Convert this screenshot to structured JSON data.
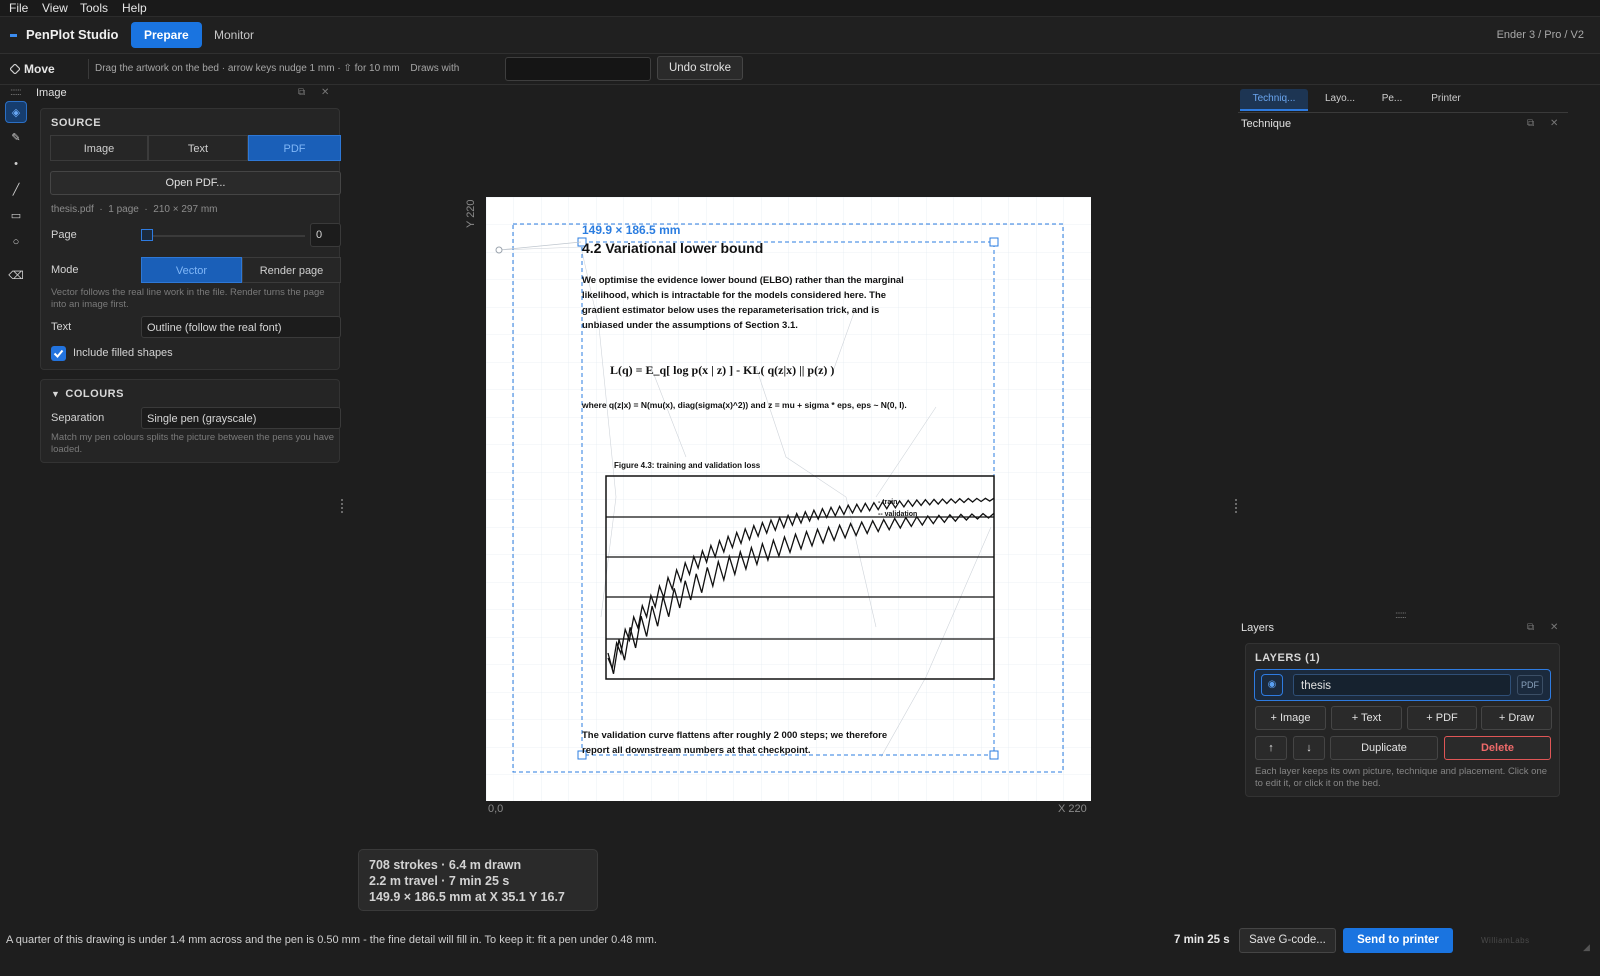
{
  "menu": [
    "File",
    "View",
    "Tools",
    "Help"
  ],
  "app": {
    "name": "PenPlot Studio",
    "tabs": [
      "Prepare",
      "Monitor"
    ],
    "printer": "Ender 3 / Pro / V2"
  },
  "toolbar": {
    "tool": "Move",
    "hint": "Drag the artwork on the bed · arrow keys nudge 1 mm · ⇧ for 10 mm",
    "draws_with_label": "Draws with",
    "draws_with_value": "",
    "undo": "Undo stroke"
  },
  "tools": [
    "move-icon",
    "pen-icon",
    "dot-icon",
    "line-icon",
    "rect-icon",
    "circle-icon",
    "eraser-icon"
  ],
  "image_panel": {
    "title": "Image",
    "source": {
      "heading": "SOURCE",
      "options": [
        "Image",
        "Text",
        "PDF"
      ],
      "selected": "PDF",
      "open_button": "Open PDF...",
      "file_info": "thesis.pdf  ·  1 page  ·  210 × 297 mm",
      "page_label": "Page",
      "page_value": "0",
      "mode_label": "Mode",
      "mode_options": [
        "Vector",
        "Render page"
      ],
      "mode_selected": "Vector",
      "mode_help": "Vector follows the real line work in the file. Render turns the page into an image first.",
      "text_label": "Text",
      "text_value": "Outline (follow the real font)",
      "filled_label": "Include filled shapes",
      "filled_checked": true
    },
    "colours": {
      "heading": "COLOURS",
      "separation_label": "Separation",
      "separation_value": "Single pen (grayscale)",
      "help": "Match my pen colours splits the picture between the pens you have loaded."
    }
  },
  "bed": {
    "y_label": "Y 220",
    "x_label": "X 220",
    "origin_label": "0,0",
    "selection_dims": "149.9 × 186.5 mm"
  },
  "artwork": {
    "heading": "4.2  Variational lower bound",
    "para1": [
      "We optimise the evidence lower bound (ELBO) rather than the marginal",
      "likelihood, which is intractable for the models considered here. The",
      "gradient estimator below uses the reparameterisation trick, and is",
      "unbiased under the assumptions of Section 3.1."
    ],
    "equation": "L(q) = E_q[ log p(x | z) ]  -  KL( q(z|x) || p(z) )",
    "where": "where q(z|x) = N(mu(x), diag(sigma(x)^2)) and z = mu + sigma * eps,   eps ~ N(0, I).",
    "figure_caption": "Figure 4.3: training and validation loss",
    "legend_train": "- train",
    "legend_val": "-- validation",
    "para2": [
      "The validation curve flattens after roughly 2 000 steps; we therefore",
      "report all downstream numbers at that checkpoint."
    ]
  },
  "stats": {
    "line1": "708 strokes  ·  6.4 m drawn",
    "line2": "2.2 m travel  ·  7 min 25 s",
    "line3": "149.9 × 186.5 mm at X 35.1  Y 16.7"
  },
  "right": {
    "tabs": [
      "Techniq...",
      "Layo...",
      "Pe...",
      "Printer"
    ],
    "technique_title": "Technique",
    "layers_title": "Layers",
    "layers_heading": "LAYERS  (1)",
    "layer_name": "thesis",
    "layer_badge": "PDF",
    "add_buttons": [
      "+ Image",
      "+ Text",
      "+ PDF",
      "+ Draw"
    ],
    "duplicate": "Duplicate",
    "delete": "Delete",
    "help": "Each layer keeps its own picture, technique and placement. Click one to edit it, or click it on the bed."
  },
  "status": {
    "message": "A quarter of this drawing is under 1.4 mm across and the pen is 0.50 mm - the fine detail will fill in. To keep it: fit a pen under 0.48 mm.",
    "time": "7 min 25 s",
    "save": "Save G-code...",
    "send": "Send to printer",
    "brand": "WilliamLabs"
  },
  "colors": {
    "accent": "#1a74e0",
    "selection": "#2b7de0",
    "danger": "#e05656"
  }
}
